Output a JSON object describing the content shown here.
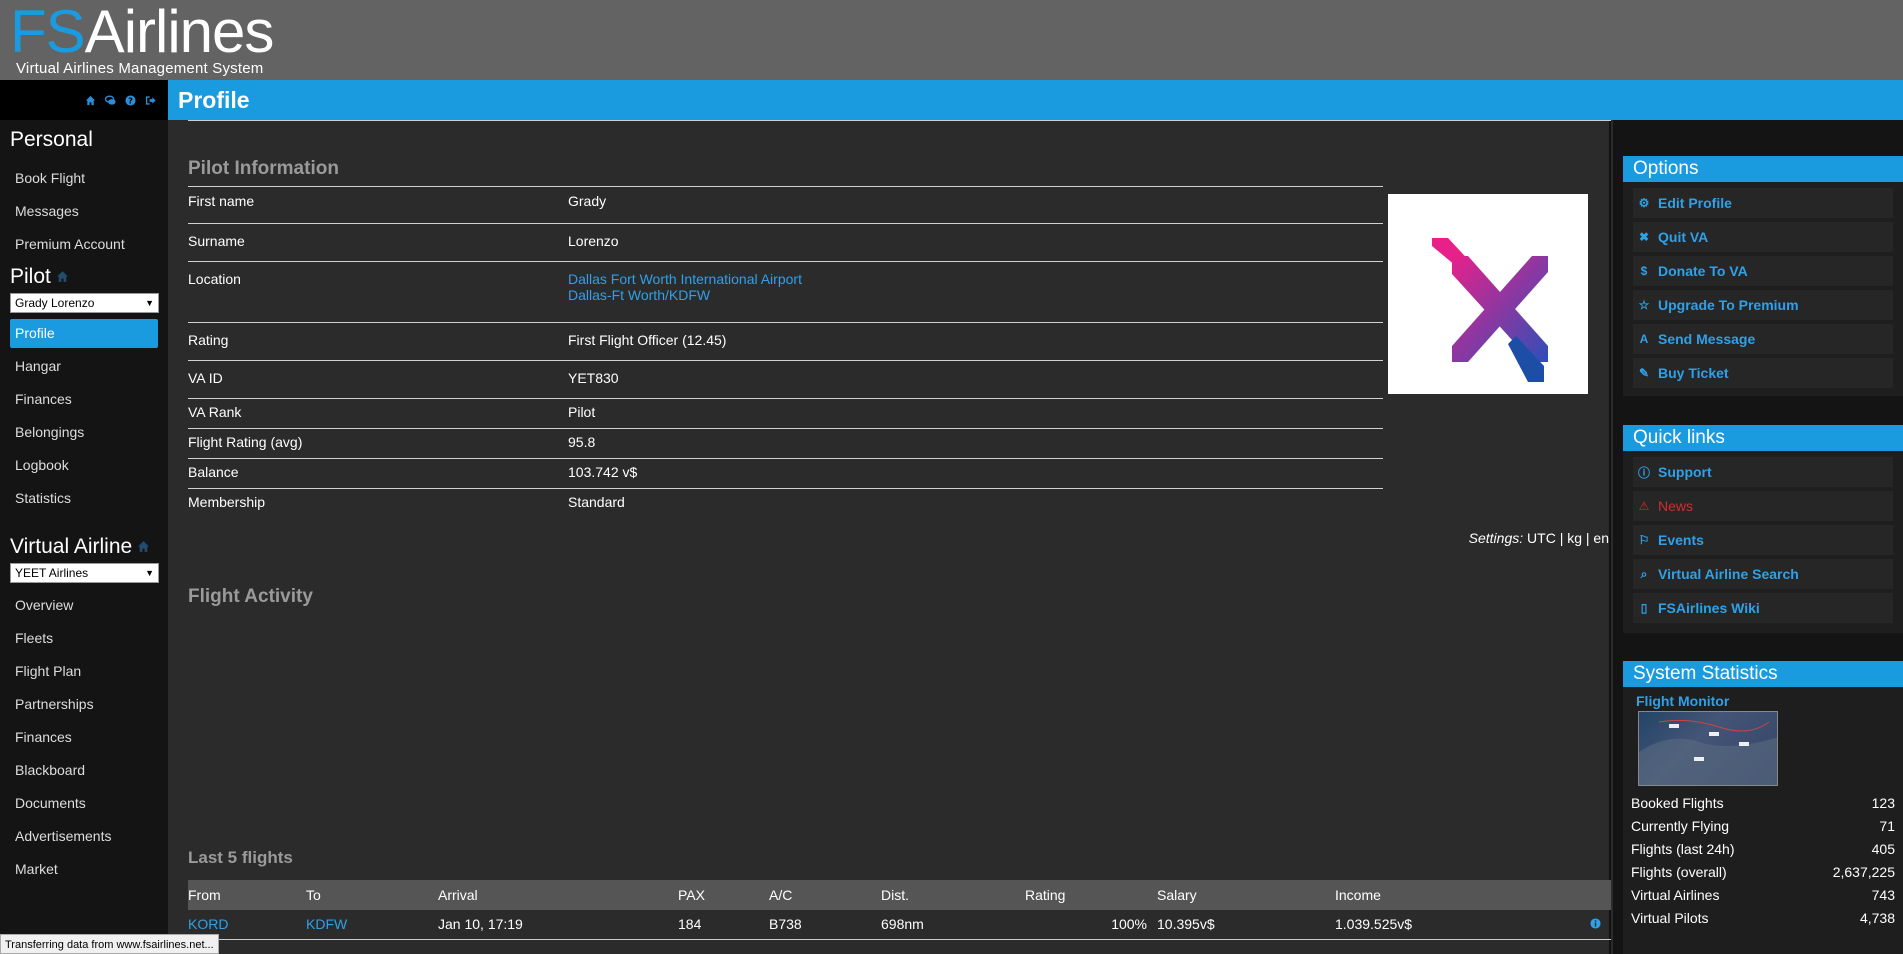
{
  "logo": {
    "fs": "FS",
    "airlines": "Airlines",
    "subtitle": "Virtual Airlines Management System"
  },
  "page_title": "Profile",
  "sidebar": {
    "personal_heading": "Personal",
    "personal_items": [
      "Book Flight",
      "Messages",
      "Premium Account"
    ],
    "pilot_heading": "Pilot",
    "pilot_select": "Grady Lorenzo",
    "pilot_items": [
      "Profile",
      "Hangar",
      "Finances",
      "Belongings",
      "Logbook",
      "Statistics"
    ],
    "va_heading": "Virtual Airline",
    "va_select": "YEET Airlines",
    "va_items": [
      "Overview",
      "Fleets",
      "Flight Plan",
      "Partnerships",
      "Finances",
      "Blackboard",
      "Documents",
      "Advertisements",
      "Market"
    ]
  },
  "pilot_info": {
    "title": "Pilot Information",
    "rows": [
      {
        "label": "First name",
        "value": "Grady"
      },
      {
        "label": "Surname",
        "value": "Lorenzo"
      },
      {
        "label": "Location",
        "value": "Dallas Fort Worth International Airport",
        "value2": "Dallas-Ft Worth/KDFW"
      },
      {
        "label": "Rating",
        "value": "First Flight Officer (12.45)"
      },
      {
        "label": "VA ID",
        "value": "YET830"
      },
      {
        "label": "VA Rank",
        "value": "Pilot"
      },
      {
        "label": "Flight Rating (avg)",
        "value": "95.8"
      },
      {
        "label": "Balance",
        "value": "103.742 v$"
      },
      {
        "label": "Membership",
        "value": "Standard"
      }
    ]
  },
  "settings": {
    "label": "Settings:",
    "value": " UTC | kg | en"
  },
  "flight_activity_title": "Flight Activity",
  "last_flights": {
    "title": "Last 5 flights",
    "headers": [
      "From",
      "To",
      "Arrival",
      "PAX",
      "A/C",
      "Dist.",
      "Rating",
      "Salary",
      "Income"
    ],
    "rows": [
      {
        "from": "KORD",
        "to": "KDFW",
        "arrival": "Jan 10, 17:19",
        "pax": "184",
        "ac": "B738",
        "dist": "698nm",
        "rating": "100%",
        "salary": "10.395v$",
        "income": "1.039.525v$"
      }
    ]
  },
  "options": {
    "title": "Options",
    "items": [
      {
        "label": "Edit Profile",
        "icon": "gear-icon"
      },
      {
        "label": "Quit VA",
        "icon": "close-icon"
      },
      {
        "label": "Donate To VA",
        "icon": "dollar-icon"
      },
      {
        "label": "Upgrade To Premium",
        "icon": "star-icon"
      },
      {
        "label": "Send Message",
        "icon": "font-icon"
      },
      {
        "label": "Buy Ticket",
        "icon": "ticket-icon"
      }
    ]
  },
  "quick_links": {
    "title": "Quick links",
    "items": [
      {
        "label": "Support",
        "icon": "info-icon"
      },
      {
        "label": "News",
        "icon": "warning-icon"
      },
      {
        "label": "Events",
        "icon": "flag-icon"
      },
      {
        "label": "Virtual Airline Search",
        "icon": "search-icon"
      },
      {
        "label": "FSAirlines Wiki",
        "icon": "document-icon"
      }
    ]
  },
  "system_stats": {
    "title": "System Statistics",
    "monitor_label": "Flight Monitor",
    "rows": [
      {
        "label": "Booked Flights",
        "value": "123"
      },
      {
        "label": "Currently Flying",
        "value": "71"
      },
      {
        "label": "Flights (last 24h)",
        "value": "405"
      },
      {
        "label": "Flights (overall)",
        "value": "2,637,225"
      },
      {
        "label": "Virtual Airlines",
        "value": "743"
      },
      {
        "label": "Virtual Pilots",
        "value": "4,738"
      }
    ]
  },
  "status_bar": "Transferring data from www.fsairlines.net..."
}
